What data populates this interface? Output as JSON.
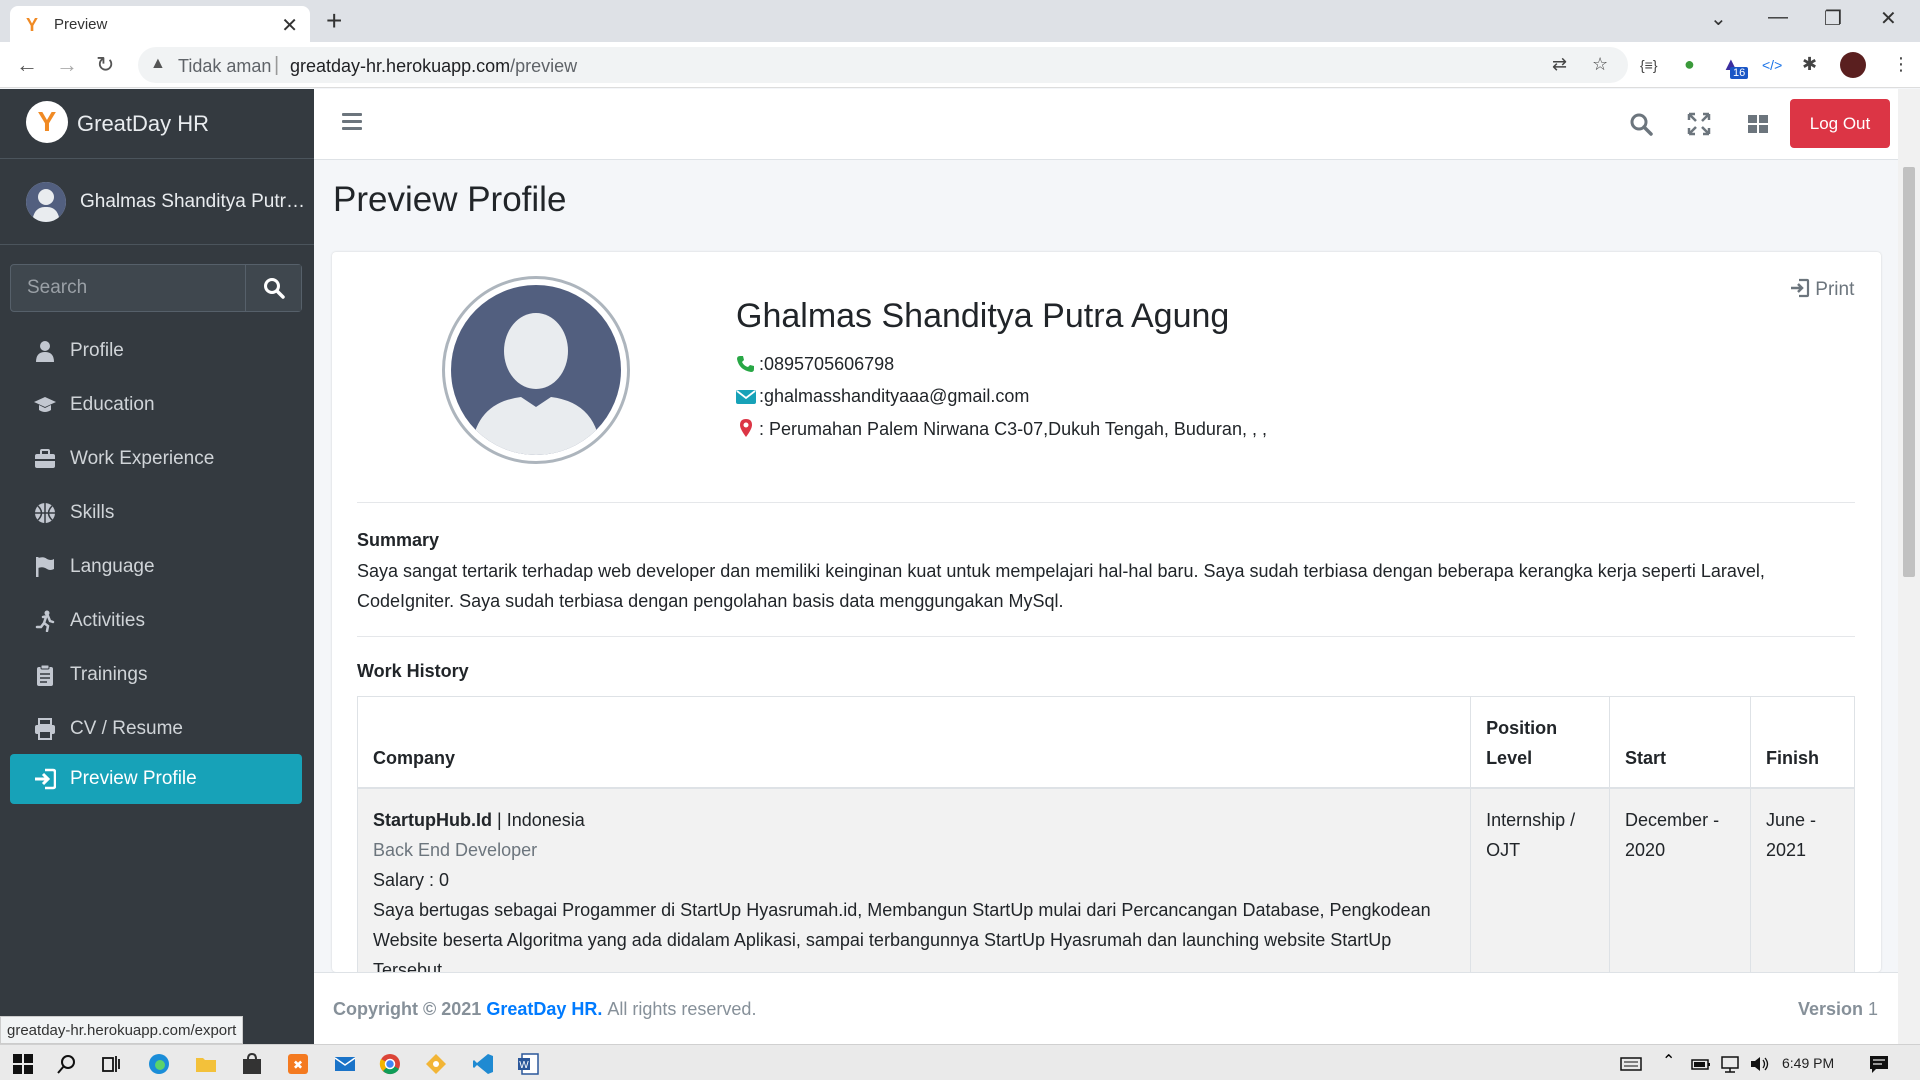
{
  "browser": {
    "tab_title": "Preview",
    "security_label": "Tidak aman",
    "url_host": "greatday-hr.herokuapp.com",
    "url_path": "/preview",
    "extension_badge": "16",
    "status_url": "greatday-hr.herokuapp.com/export"
  },
  "sidebar": {
    "brand": "GreatDay HR",
    "user_name": "Ghalmas Shanditya Putra..",
    "search_placeholder": "Search",
    "items": [
      {
        "label": "Profile",
        "icon": "user-icon"
      },
      {
        "label": "Education",
        "icon": "graduation-cap-icon"
      },
      {
        "label": "Work Experience",
        "icon": "briefcase-icon"
      },
      {
        "label": "Skills",
        "icon": "basketball-icon"
      },
      {
        "label": "Language",
        "icon": "flag-icon"
      },
      {
        "label": "Activities",
        "icon": "running-icon"
      },
      {
        "label": "Trainings",
        "icon": "clipboard-icon"
      },
      {
        "label": "CV / Resume",
        "icon": "printer-icon"
      },
      {
        "label": "Preview Profile",
        "icon": "sign-in-icon",
        "active": true
      }
    ]
  },
  "topnav": {
    "logout_label": "Log Out"
  },
  "page": {
    "title": "Preview Profile",
    "print_label": "Print",
    "profile": {
      "name": "Ghalmas Shanditya Putra Agung",
      "phone": ":0895705606798",
      "email": ":ghalmasshandityaaa@gmail.com",
      "address": ": Perumahan Palem Nirwana C3-07,Dukuh Tengah, Buduran, , ,"
    },
    "summary": {
      "heading": "Summary",
      "text": "Saya sangat tertarik terhadap web developer dan memiliki keinginan kuat untuk mempelajari hal-hal baru. Saya sudah terbiasa dengan beberapa kerangka kerja seperti Laravel, CodeIgniter. Saya sudah terbiasa dengan pengolahan basis data menggungakan MySql."
    },
    "work_history": {
      "heading": "Work History",
      "columns": {
        "company": "Company",
        "position": "Position Level",
        "start": "Start",
        "finish": "Finish"
      },
      "rows": [
        {
          "company": "StartupHub.Id",
          "country": "| Indonesia",
          "role": "Back End Developer",
          "salary": "Salary : 0",
          "description": "Saya bertugas sebagai Progammer di StartUp Hyasrumah.id, Membangun StartUp mulai dari Percancangan Database, Pengkodean Website beserta Algoritma yang ada didalam Aplikasi, sampai terbangunnya StartUp Hyasrumah dan launching website StartUp Tersebut",
          "position": "Internship / OJT",
          "start": "December - 2020",
          "finish": "June - 2021"
        }
      ]
    }
  },
  "footer": {
    "copyright": "Copyright © 2021",
    "brand": "GreatDay HR.",
    "rights": "All rights reserved.",
    "version_label": "Version",
    "version": "1"
  },
  "taskbar": {
    "time": "6:49 PM"
  },
  "colors": {
    "sidebar_bg": "#343a40",
    "active_item": "#17a2b8",
    "logout": "#dc3545",
    "link": "#007bff"
  }
}
